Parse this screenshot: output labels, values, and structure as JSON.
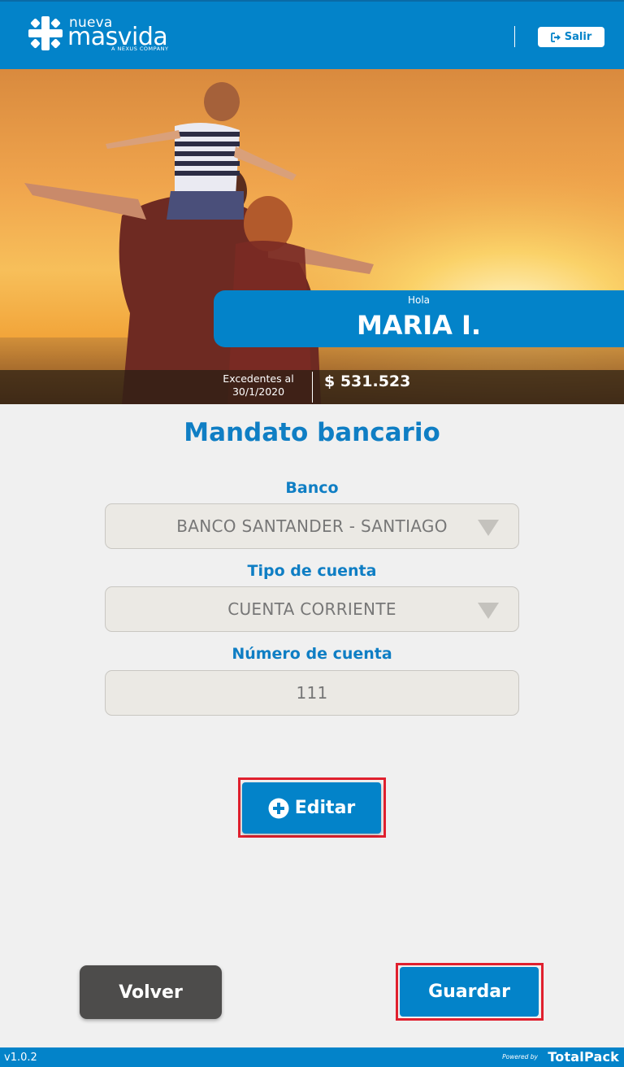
{
  "header": {
    "logo_small": "nueva",
    "logo_main": "masvida",
    "logo_tagline": "A NEXUS COMPANY",
    "logout_label": "Salir",
    "logout_icon": "sign-out-icon"
  },
  "hero": {
    "greeting": "Hola",
    "user_name": "MARIA I.",
    "surplus_label_line1": "Excedentes al",
    "surplus_label_line2": "30/1/2020",
    "surplus_amount": "$ 531.523"
  },
  "main": {
    "title": "Mandato bancario",
    "bank_label": "Banco",
    "bank_value": "BANCO SANTANDER - SANTIAGO",
    "account_type_label": "Tipo de cuenta",
    "account_type_value": "CUENTA CORRIENTE",
    "account_number_label": "Número de cuenta",
    "account_number_value": "111",
    "edit_button": "Editar",
    "edit_icon": "plus-circle-icon"
  },
  "actions": {
    "back_button": "Volver",
    "save_button": "Guardar"
  },
  "footer": {
    "version": "v1.0.2",
    "powered_by": "Powered by",
    "brand": "TotalPack"
  },
  "colors": {
    "primary": "#0383c9",
    "title_blue": "#0f7ec4",
    "highlight": "#e0202e",
    "dark_button": "#4d4c4b"
  }
}
